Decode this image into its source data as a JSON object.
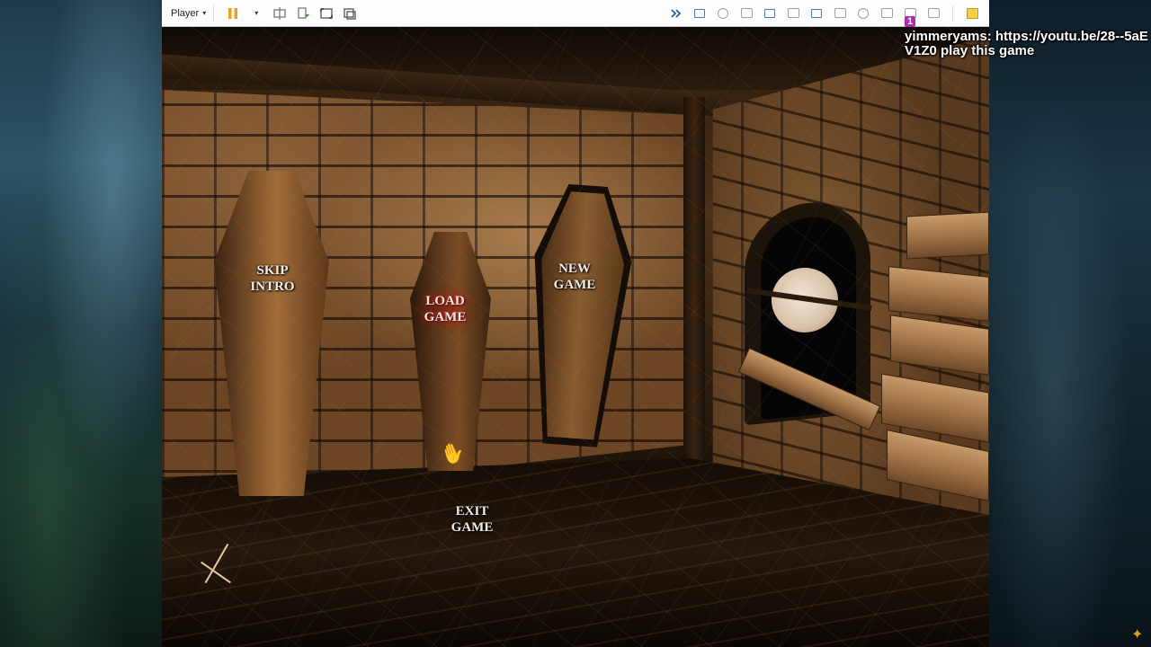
{
  "toolbar": {
    "player_label": "Player",
    "caret": "▾"
  },
  "game_menu": {
    "skip_intro": "SKIP\nINTRO",
    "load_game": "LOAD\nGAME",
    "new_game": "NEW\nGAME",
    "exit_game": "EXIT\nGAME"
  },
  "overlay": {
    "badge": "1",
    "chat_message": "yimmeryams: https://youtu.be/28--5aEV1Z0 play this game"
  },
  "colors": {
    "load_glow": "#e0202a",
    "toolbar_bg": "#fdfdfd"
  },
  "icons": {
    "pause": "pause-icon",
    "send_ctrl_alt_del": "ctrl-alt-del-icon",
    "fullscreen": "fullscreen-icon",
    "unity": "unity-icon",
    "note": "note-icon",
    "hand": "hand-cursor-icon"
  }
}
